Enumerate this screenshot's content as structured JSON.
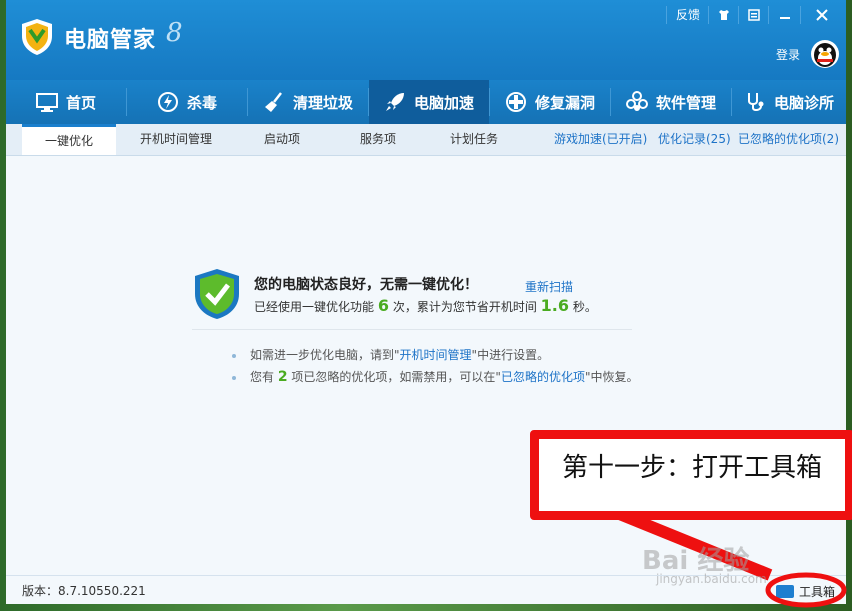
{
  "app": {
    "title": "电脑管家",
    "version_mark": "8"
  },
  "titlebar": {
    "feedback": "反馈",
    "login": "登录"
  },
  "nav": {
    "items": [
      {
        "label": "首页",
        "icon": "monitor-icon"
      },
      {
        "label": "杀毒",
        "icon": "lightning-icon"
      },
      {
        "label": "清理垃圾",
        "icon": "broom-icon"
      },
      {
        "label": "电脑加速",
        "icon": "rocket-icon"
      },
      {
        "label": "修复漏洞",
        "icon": "patch-icon"
      },
      {
        "label": "软件管理",
        "icon": "flower-icon"
      },
      {
        "label": "电脑诊所",
        "icon": "stethoscope-icon"
      }
    ],
    "active": "电脑加速"
  },
  "subnav": {
    "tabs": [
      "一键优化",
      "开机时间管理",
      "启动项",
      "服务项",
      "计划任务"
    ],
    "links": [
      "游戏加速(已开启)",
      "优化记录(25)",
      "已忽略的优化项(2)"
    ]
  },
  "status": {
    "title": "您的电脑状态良好，无需一键优化！",
    "rescan": "重新扫描",
    "line_pre": "已经使用一键优化功能",
    "times": "6",
    "line_mid": "次，累计为您节省开机时间",
    "seconds": "1.6",
    "line_post": "秒。"
  },
  "tips": {
    "tip1_pre": "如需进一步优化电脑，请到\"",
    "tip1_link": "开机时间管理",
    "tip1_post": "\"中进行设置。",
    "tip2_pre": "您有",
    "tip2_count": "2",
    "tip2_mid": "项已忽略的优化项，如需禁用，可以在\"",
    "tip2_link": "已忽略的优化项",
    "tip2_post": "\"中恢复。"
  },
  "footer": {
    "version": "版本：8.7.10550.221",
    "toolbox": "工具箱"
  },
  "annotation": {
    "text": "第十一步：打开工具箱",
    "color": "#ee1010"
  },
  "watermark": {
    "text": "Bai 经验",
    "url_text": "jingyan.baidu.com"
  },
  "colors": {
    "accent": "#1a7fcd",
    "green": "#4aab21",
    "link": "#1e73c7"
  }
}
